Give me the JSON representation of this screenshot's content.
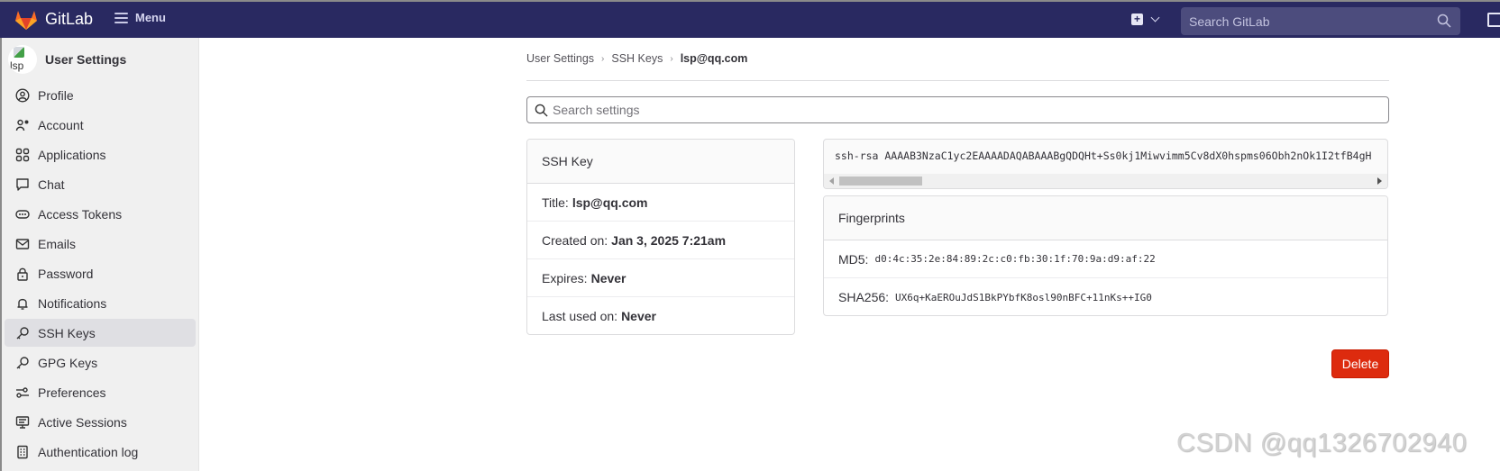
{
  "header": {
    "brand": "GitLab",
    "menu_label": "Menu",
    "search_placeholder": "Search GitLab",
    "colors": {
      "background": "#292961",
      "search_bg": "#4c4c7d"
    }
  },
  "sidebar": {
    "context_title": "User Settings",
    "avatar_alt": "lsp",
    "items": [
      {
        "label": "Profile",
        "icon": "profile-icon"
      },
      {
        "label": "Account",
        "icon": "account-icon"
      },
      {
        "label": "Applications",
        "icon": "applications-icon"
      },
      {
        "label": "Chat",
        "icon": "chat-icon"
      },
      {
        "label": "Access Tokens",
        "icon": "token-icon"
      },
      {
        "label": "Emails",
        "icon": "mail-icon"
      },
      {
        "label": "Password",
        "icon": "lock-icon"
      },
      {
        "label": "Notifications",
        "icon": "bell-icon"
      },
      {
        "label": "SSH Keys",
        "icon": "key-icon",
        "active": true
      },
      {
        "label": "GPG Keys",
        "icon": "key-icon"
      },
      {
        "label": "Preferences",
        "icon": "preferences-icon"
      },
      {
        "label": "Active Sessions",
        "icon": "monitor-icon"
      },
      {
        "label": "Authentication log",
        "icon": "log-icon"
      }
    ]
  },
  "breadcrumb": {
    "items": [
      "User Settings",
      "SSH Keys"
    ],
    "current": "lsp@qq.com"
  },
  "settings_search": {
    "placeholder": "Search settings"
  },
  "ssh_key_card": {
    "header": "SSH Key",
    "rows": [
      {
        "label": "Title:",
        "value": "lsp@qq.com"
      },
      {
        "label": "Created on:",
        "value": "Jan 3, 2025 7:21am"
      },
      {
        "label": "Expires:",
        "value": "Never"
      },
      {
        "label": "Last used on:",
        "value": "Never"
      }
    ]
  },
  "key_text": "ssh-rsa AAAAB3NzaC1yc2EAAAADAQABAAABgQDQHt+Ss0kj1Miwvimm5Cv8dX0hspms06Obh2nOk1I2tfB4gH",
  "fingerprints": {
    "header": "Fingerprints",
    "rows": [
      {
        "label": "MD5:",
        "value": "d0:4c:35:2e:84:89:2c:c0:fb:30:1f:70:9a:d9:af:22"
      },
      {
        "label": "SHA256:",
        "value": "UX6q+KaEROuJdS1BkPYbfK8osl90nBFC+11nKs++IG0"
      }
    ]
  },
  "actions": {
    "delete_label": "Delete",
    "delete_color": "#dd2b0e"
  },
  "watermark": "CSDN @qq1326702940"
}
